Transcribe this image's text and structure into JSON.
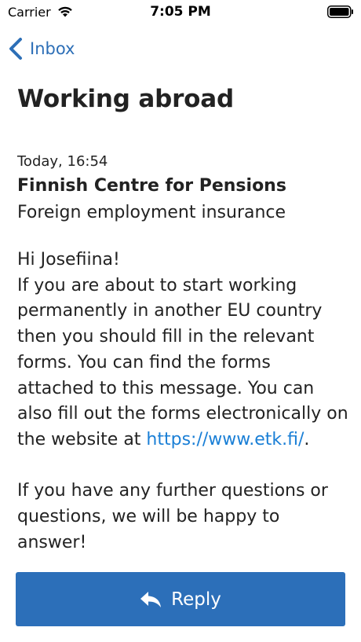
{
  "status_bar": {
    "carrier": "Carrier",
    "time": "7:05 PM"
  },
  "nav": {
    "back_label": "Inbox"
  },
  "message": {
    "title": "Working abroad",
    "timestamp": "Today, 16:54",
    "sender": "Finnish Centre for Pensions",
    "subject": "Foreign employment insurance",
    "greeting": "Hi Josefiina!",
    "paragraph1_before_link": "If you are about to start working permanently in another EU country then you should fill in the relevant forms. You can find the forms attached to this message. You can also fill out the forms electronically on the website at ",
    "link_text": "https://www.etk.fi/",
    "paragraph1_after_link": ".",
    "paragraph2": "If you have any further questions or questions, we will be happy to answer!"
  },
  "actions": {
    "reply_label": "Reply"
  },
  "colors": {
    "accent": "#2d6fb7",
    "link": "#1a7fd6",
    "button_bg": "#2c6fb9"
  }
}
